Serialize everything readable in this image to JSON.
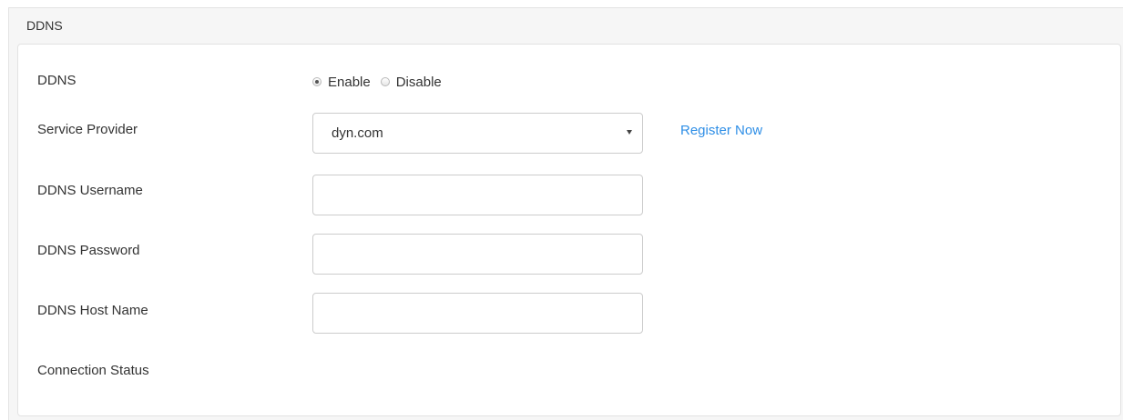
{
  "section": {
    "title": "DDNS"
  },
  "form": {
    "ddns": {
      "label": "DDNS",
      "options": [
        "Enable",
        "Disable"
      ],
      "selected": "Enable"
    },
    "service_provider": {
      "label": "Service Provider",
      "value": "dyn.com",
      "register_link": "Register Now"
    },
    "username": {
      "label": "DDNS Username",
      "value": ""
    },
    "password": {
      "label": "DDNS Password",
      "value": ""
    },
    "host_name": {
      "label": "DDNS Host Name",
      "value": ""
    },
    "connection_status": {
      "label": "Connection Status",
      "value": ""
    }
  },
  "colors": {
    "link": "#2e8ee6",
    "panel_bg": "#f6f6f6",
    "card_border": "#e2e2e2"
  }
}
